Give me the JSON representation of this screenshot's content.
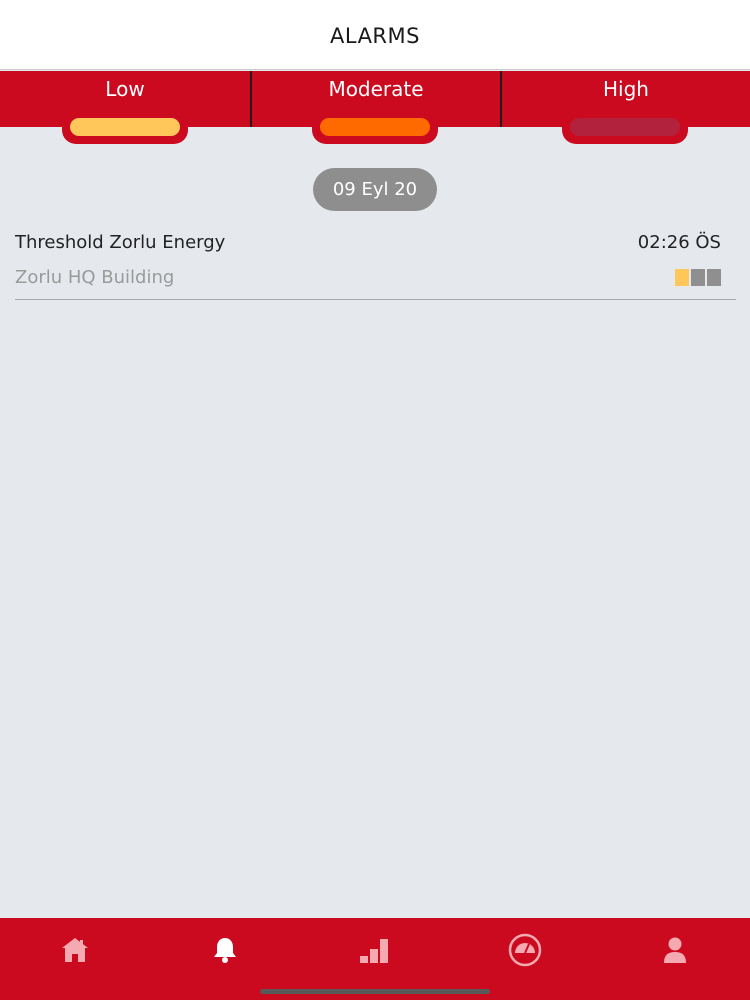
{
  "header": {
    "title": "ALARMS"
  },
  "filters": [
    {
      "label": "Low",
      "color": "#ffc65a"
    },
    {
      "label": "Moderate",
      "color": "#ff6a00"
    },
    {
      "label": "High",
      "color": "#b3223d"
    }
  ],
  "date_group": "09 Eyl 20",
  "alarms": [
    {
      "title": "Threshold Zorlu Energy",
      "time": "02:26 ÖS",
      "subtitle": "Zorlu HQ Building",
      "severity_colors": [
        "#ffc65a",
        "#8f8f8f",
        "#8f8f8f"
      ]
    }
  ],
  "tabbar": {
    "items": [
      {
        "icon": "home-icon"
      },
      {
        "icon": "bell-icon"
      },
      {
        "icon": "bar-chart-icon"
      },
      {
        "icon": "gauge-icon"
      },
      {
        "icon": "user-icon"
      }
    ]
  },
  "colors": {
    "brand_red": "#cc0a1f",
    "background": "#e5e9ee",
    "date_chip": "#8e8e8e",
    "icon_tint": "#f5a9b0"
  }
}
